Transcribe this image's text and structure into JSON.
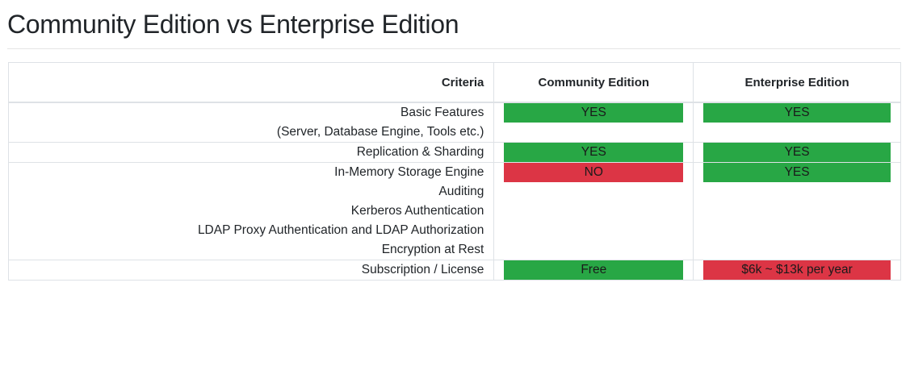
{
  "page": {
    "title": "Community Edition vs Enterprise Edition"
  },
  "table": {
    "headers": {
      "criteria": "Criteria",
      "community": "Community Edition",
      "enterprise": "Enterprise Edition"
    },
    "rows": [
      {
        "criteria": [
          "Basic Features",
          "(Server, Database Engine, Tools etc.)"
        ],
        "community": {
          "text": "YES",
          "status": "positive"
        },
        "enterprise": {
          "text": "YES",
          "status": "positive"
        }
      },
      {
        "criteria": [
          "Replication & Sharding"
        ],
        "community": {
          "text": "YES",
          "status": "positive"
        },
        "enterprise": {
          "text": "YES",
          "status": "positive"
        }
      },
      {
        "criteria": [
          "In-Memory Storage Engine",
          "Auditing",
          "Kerberos Authentication",
          "LDAP Proxy Authentication and LDAP Authorization",
          "Encryption at Rest"
        ],
        "community": {
          "text": "NO",
          "status": "negative"
        },
        "enterprise": {
          "text": "YES",
          "status": "positive"
        }
      },
      {
        "criteria": [
          "Subscription / License"
        ],
        "community": {
          "text": "Free",
          "status": "positive"
        },
        "enterprise": {
          "text": "$6k ~ $13k per year",
          "status": "negative"
        }
      }
    ]
  },
  "colors": {
    "positive": "#28a745",
    "negative": "#dc3545",
    "border": "#dee2e6"
  }
}
